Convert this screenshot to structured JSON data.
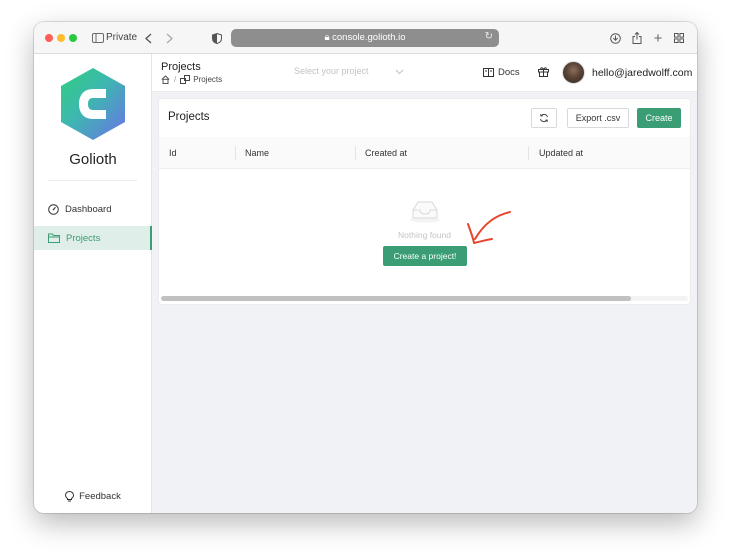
{
  "browser": {
    "private_label": "Private",
    "url": "console.golioth.io"
  },
  "sidebar": {
    "brand": "Golioth",
    "items": [
      {
        "label": "Dashboard",
        "icon": "dashboard-icon",
        "active": false
      },
      {
        "label": "Projects",
        "icon": "folder-icon",
        "active": true
      }
    ],
    "feedback_label": "Feedback",
    "collapse_glyph": "<"
  },
  "header": {
    "title": "Projects",
    "breadcrumb": "Projects",
    "project_select_placeholder": "Select your project",
    "docs_label": "Docs",
    "user_email": "hello@jaredwolff.com"
  },
  "card": {
    "title": "Projects",
    "export_label": "Export .csv",
    "create_label": "Create",
    "columns": [
      "Id",
      "Name",
      "Created at",
      "Updated at"
    ],
    "empty_text": "Nothing found",
    "empty_create_label": "Create a project!"
  },
  "colors": {
    "accent": "#3a9d74",
    "annotation_arrow": "#e8462c"
  }
}
